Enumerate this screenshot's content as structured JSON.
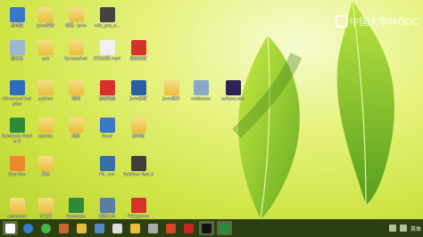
{
  "watermark": {
    "text": "中国大学MOOC"
  },
  "desktop_icons": [
    {
      "label": "此电脑",
      "color": "#3a78c8"
    },
    {
      "label": "Java编程",
      "color": "#e9bd3d"
    },
    {
      "label": "新建 - Java",
      "color": "#e9bd3d"
    },
    {
      "label": "mbr_pro_e...",
      "color": "#444444"
    },
    {
      "label": "回收站",
      "color": "#9bb7cf"
    },
    {
      "label": "ppt",
      "color": "#e9bd3d"
    },
    {
      "label": "Screenshot",
      "color": "#e9bd3d"
    },
    {
      "label": "片头片尾 mp4",
      "color": "#f0f0f0"
    },
    {
      "label": "极域课堂",
      "color": "#d6312a"
    },
    {
      "label": "Advanced Installer",
      "color": "#2f6dbb"
    },
    {
      "label": "python",
      "color": "#e9bd3d"
    },
    {
      "label": "说明",
      "color": "#e9bd3d"
    },
    {
      "label": "百度网盘",
      "color": "#d6312a"
    },
    {
      "label": "Java课堂",
      "color": "#2b5ea8"
    },
    {
      "label": "netbeans",
      "color": "#8aa9c7"
    },
    {
      "label": "eclipse.exe",
      "color": "#2c2255"
    },
    {
      "label": "Camtasia Studio 8",
      "color": "#2e8a3b"
    },
    {
      "label": "update",
      "color": "#e9bd3d"
    },
    {
      "label": "视频",
      "color": "#e9bd3d"
    },
    {
      "label": "Pand",
      "color": "#3a78c8"
    },
    {
      "label": "新学期",
      "color": "#e9bd3d"
    },
    {
      "label": "Java课件",
      "color": "#e9bd3d"
    },
    {
      "label": "Epic Pen",
      "color": "#e98a2b"
    },
    {
      "label": "素材",
      "color": "#e9bd3d"
    },
    {
      "label": "Fli...ver",
      "color": "#3a6ea8"
    },
    {
      "label": "Sublime Text 3",
      "color": "#3f3f3f"
    },
    {
      "label": "ucancam",
      "color": "#e9bd3d"
    },
    {
      "label": "小工具",
      "color": "#e9bd3d"
    },
    {
      "label": "Camtasia",
      "color": "#2e8a3b"
    },
    {
      "label": "截图工具",
      "color": "#5a7ea6"
    },
    {
      "label": "FSCapture",
      "color": "#d6312a"
    }
  ],
  "taskbar": {
    "apps": [
      {
        "name": "start",
        "color": "#ffffff"
      },
      {
        "name": "ie",
        "color": "#2f7fd0"
      },
      {
        "name": "360",
        "color": "#4ab34a"
      },
      {
        "name": "pen",
        "color": "#cc6633"
      },
      {
        "name": "explorer",
        "color": "#e9bd3d"
      },
      {
        "name": "player",
        "color": "#5588cc"
      },
      {
        "name": "monitor",
        "color": "#dddddd"
      },
      {
        "name": "photo",
        "color": "#e9bd3d"
      },
      {
        "name": "settings",
        "color": "#aaaaaa"
      },
      {
        "name": "powerpoint",
        "color": "#d24726"
      },
      {
        "name": "app",
        "color": "#cc2222"
      },
      {
        "name": "cmd",
        "color": "#111111"
      },
      {
        "name": "camtasia",
        "color": "#2e8a3b"
      }
    ],
    "tray_text": "英体"
  }
}
